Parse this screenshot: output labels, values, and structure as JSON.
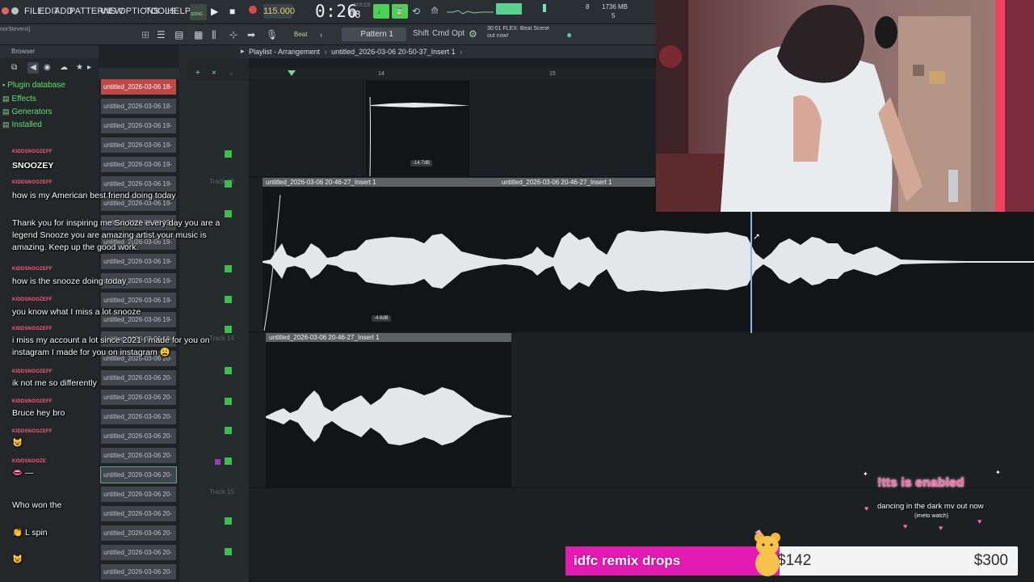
{
  "menubar": {
    "items": [
      "FILE",
      "EDIT",
      "ADD",
      "PATTERNS",
      "VIEW",
      "OPTIONS",
      "TOOLS",
      "HELP"
    ],
    "song_mode": "SONG",
    "tempo": "115.000",
    "time_main": "0:26",
    "time_sub": "08",
    "time_unit": "M:S:CS",
    "cpu_count": "8",
    "memory": "1736 MB",
    "poly": "5"
  },
  "toolbar2": {
    "user_tag": "norStevens]",
    "beat_label": "Beat",
    "pattern": "Pattern 1",
    "shift": "Shift",
    "cmd": "Cmd",
    "opt": "Opt",
    "hint_line1": "30:01  FLEX: Beat Scene",
    "hint_line2": "out now!"
  },
  "browser": {
    "title": "Browser",
    "items": [
      {
        "icon": "db",
        "label": "Plugin database"
      },
      {
        "icon": "folder",
        "label": "Effects"
      },
      {
        "icon": "folder",
        "label": "Generators"
      },
      {
        "icon": "folder",
        "label": "Installed"
      }
    ]
  },
  "clips": [
    "untitled_2026-03-06 18-",
    "untitled_2026-03-06 18-",
    "untitled_2026-03-06 19-",
    "untitled_2026-03-06 19-",
    "untitled_2026-03-06 19-",
    "untitled_2026-03-06 19-",
    "untitled_2026-03-06 19-",
    "untitled_2026-03-06 19-",
    "untitled_2026-03-06 19-",
    "untitled_2026-03-06 19-",
    "untitled_2026-03-06 19-",
    "untitled_2026-03-06 19-",
    "untitled_2026-03-06 19-",
    "untitled_2026-03-06 19-",
    "untitled_2026-03-06 20-",
    "untitled_2026-03-06 20-",
    "untitled_2026-03-06 20-",
    "untitled_2026-03-06 20-",
    "untitled_2026-03-06 20-",
    "untitled_2026-03-06 20-",
    "untitled_2026-03-06 20-",
    "untitled_2026-03-06 20-",
    "untitled_2026-03-06 20-",
    "untitled_2026-03-06 20-",
    "untitled_2026-03-06 20-",
    "untitled_2026-03-06 20-"
  ],
  "tracks": {
    "track13": "Track 13",
    "track14": "Track 14",
    "track15": "Track 15"
  },
  "playlist": {
    "title": "Playlist - Arrangement",
    "current_clip": "untitled_2026-03-06 20-50-37_Insert 1",
    "ruler": [
      "14",
      "15"
    ],
    "clip_a_name": "untitled_2026-03-06 20-46-27_Insert 1",
    "clip_b_name": "untitled_2026-03-06 20-46-27_Insert 1",
    "clip_c_name": "untitled_2026-03-06 20-46-27_Insert 1",
    "gain_top": "-14.7dB",
    "gain_mid": "-4.6dB"
  },
  "chat": [
    {
      "user": "KIDDSNOOZEFF",
      "text": "SNOOZEY"
    },
    {
      "user": "KIDDSNOOZEFF",
      "text": "how is my American best friend doing today"
    },
    {
      "user": "",
      "text": "Thank you for inspiring me Snooze every day you are a legend Snooze you are amazing artist your music is amazing. Keep up the good work."
    },
    {
      "user": "KIDDSNOOZEFF",
      "text": "how is the snooze doing today"
    },
    {
      "user": "KIDDSNOOZEFF",
      "text": "you know what I miss a lot snooze"
    },
    {
      "user": "KIDDSNOOZEFF",
      "text": "i miss my account a lot since 2021 I made for you on instagram I made for you on instagram 😩"
    },
    {
      "user": "KIDDSNOOZEFF",
      "text": "ik not me so differently"
    },
    {
      "user": "KIDDSNOOZEFF",
      "text": "Bruce hey bro"
    },
    {
      "user": "KIDDSNOOZEFF",
      "text": "😺"
    },
    {
      "user": "KIDDSNOOZE",
      "text": "👄 —"
    },
    {
      "user": "",
      "text": "Who won the"
    },
    {
      "user": "",
      "text": "👏 L spin"
    },
    {
      "user": "",
      "text": "😺"
    }
  ],
  "overlay": {
    "tts_title": "!tts is enabled",
    "tts_sub": "dancing in the dark mv out now",
    "tts_sub2": "(imeto watch)",
    "goal_title": "idfc remix drops",
    "goal_current": "$142",
    "goal_target": "$300",
    "goal_progress": 0.473,
    "goal_color": "#e31bb2"
  },
  "colors": {
    "accent_green": "#38c04a",
    "chat_name": "#ff5a7a",
    "selected_clip": "#c14848"
  }
}
